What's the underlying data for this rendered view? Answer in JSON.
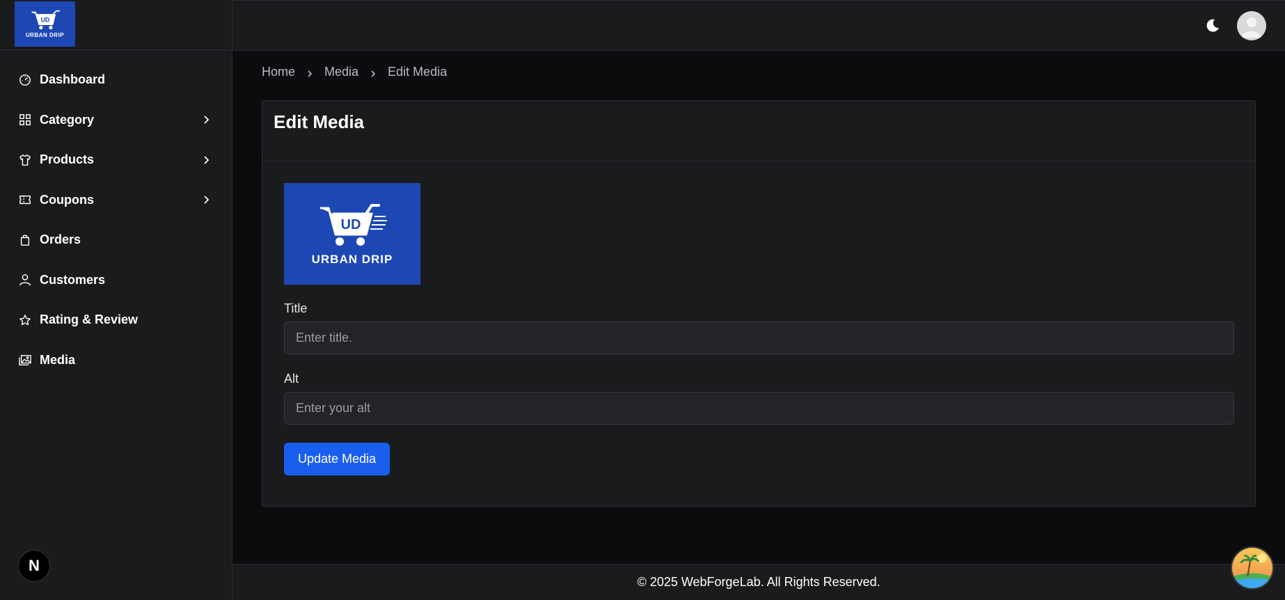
{
  "brand": {
    "logo_text": "URBAN DRIP",
    "logo_initials": "UD",
    "brand_color": "#1d48b4"
  },
  "sidebar": {
    "items": [
      {
        "label": "Dashboard",
        "icon": "gauge-icon",
        "has_submenu": false
      },
      {
        "label": "Category",
        "icon": "grid-icon",
        "has_submenu": true
      },
      {
        "label": "Products",
        "icon": "shirt-icon",
        "has_submenu": true
      },
      {
        "label": "Coupons",
        "icon": "ticket-icon",
        "has_submenu": true
      },
      {
        "label": "Orders",
        "icon": "bag-icon",
        "has_submenu": false
      },
      {
        "label": "Customers",
        "icon": "user-icon",
        "has_submenu": false
      },
      {
        "label": "Rating & Review",
        "icon": "star-icon",
        "has_submenu": false
      },
      {
        "label": "Media",
        "icon": "images-icon",
        "has_submenu": false
      }
    ],
    "badge": "N"
  },
  "topbar": {
    "theme_icon": "moon-icon",
    "avatar_icon": "avatar"
  },
  "breadcrumb": {
    "home": "Home",
    "media": "Media",
    "current": "Edit Media"
  },
  "card": {
    "title": "Edit Media",
    "title_label": "Title",
    "title_placeholder": "Enter title.",
    "alt_label": "Alt",
    "alt_placeholder": "Enter your alt",
    "button_label": "Update Media"
  },
  "footer": {
    "text": "© 2025 WebForgeLab. All Rights Reserved."
  },
  "colors": {
    "accent": "#1a5ef0",
    "background": "#0b0c0e",
    "panel": "#1a1b1d"
  }
}
